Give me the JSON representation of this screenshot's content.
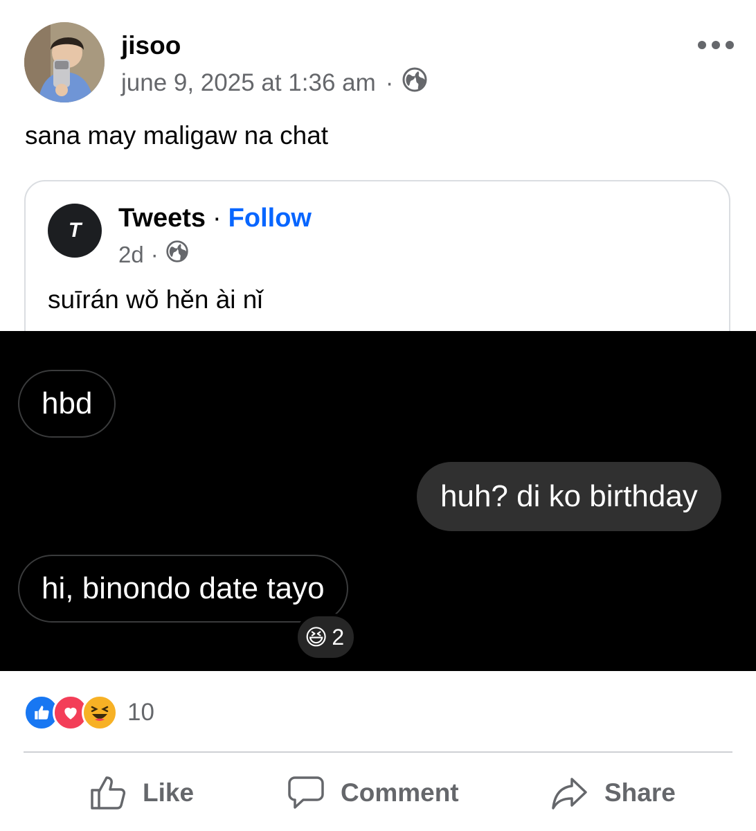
{
  "post": {
    "author": "jisoo",
    "timestamp": "june 9, 2025 at 1:36 am",
    "separator": "·",
    "audience_icon": "globe-icon",
    "more_icon": "more-options-icon",
    "text": "sana may maligaw na chat"
  },
  "shared_post": {
    "avatar_letter": "T",
    "page_name": "Tweets",
    "separator": "·",
    "follow_label": "Follow",
    "age": "2d",
    "audience_icon": "globe-icon",
    "text": "suīrán wǒ hěn ài nǐ"
  },
  "chat": {
    "messages": [
      {
        "side": "incoming",
        "text": "hbd"
      },
      {
        "side": "outgoing",
        "text": "huh? di ko birthday"
      },
      {
        "side": "incoming",
        "text": "hi, binondo date tayo"
      }
    ],
    "reaction": {
      "emoji": "😆",
      "count": "2"
    }
  },
  "reactions": {
    "types": [
      "like",
      "love",
      "haha"
    ],
    "count": "10"
  },
  "actions": {
    "like_label": "Like",
    "comment_label": "Comment",
    "share_label": "Share"
  },
  "colors": {
    "follow": "#0866ff",
    "secondary_text": "#65676b",
    "chat_background": "#000000",
    "outgoing_bubble": "#303030"
  }
}
